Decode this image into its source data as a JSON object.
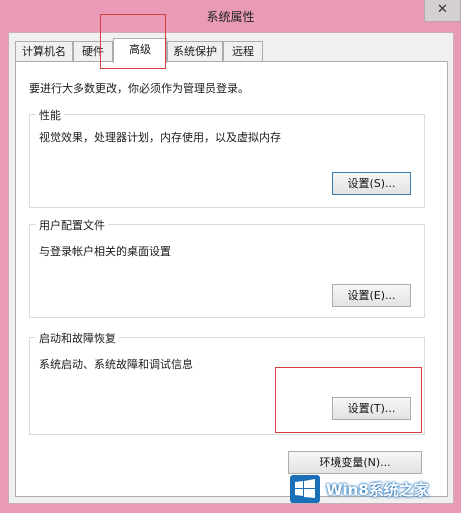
{
  "window": {
    "title": "系统属性",
    "close_glyph": "✕"
  },
  "tabs": [
    {
      "label": "计算机名",
      "active": false
    },
    {
      "label": "硬件",
      "active": false
    },
    {
      "label": "高级",
      "active": true
    },
    {
      "label": "系统保护",
      "active": false
    },
    {
      "label": "远程",
      "active": false
    }
  ],
  "intro": "要进行大多数更改，你必须作为管理员登录。",
  "performance": {
    "title": "性能",
    "description": "视觉效果，处理器计划，内存使用，以及虚拟内存",
    "button": "设置(S)..."
  },
  "user_profiles": {
    "title": "用户配置文件",
    "description": "与登录帐户相关的桌面设置",
    "button": "设置(E)..."
  },
  "startup_recovery": {
    "title": "启动和故障恢复",
    "description": "系统启动、系统故障和调试信息",
    "button": "设置(T)..."
  },
  "env_button": "环境变量(N)...",
  "watermark": {
    "text": "Win8系统之家",
    "logo_icon": "windows-logo-icon"
  },
  "colors": {
    "highlight": "#d64040",
    "window_frame": "#e89ab7",
    "logo_blue": "#1a6fb8"
  }
}
